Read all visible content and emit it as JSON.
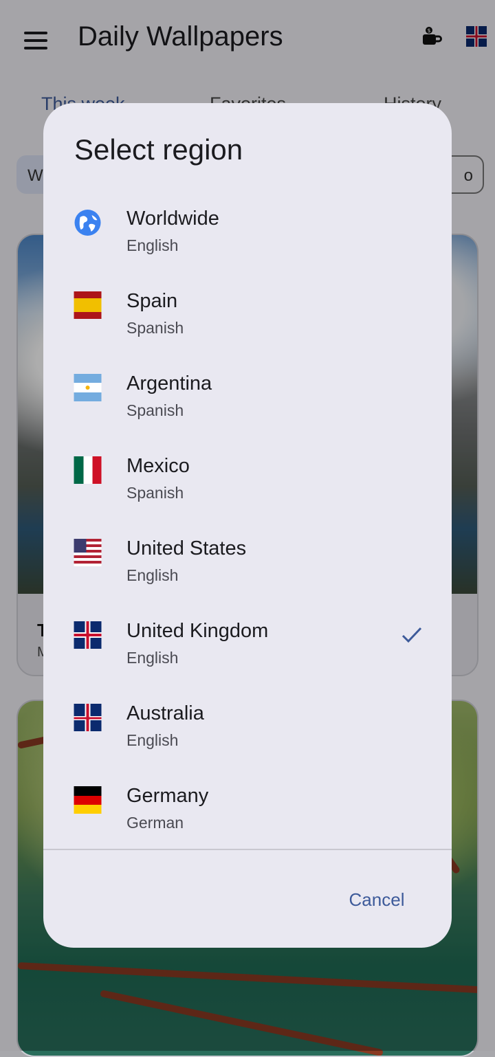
{
  "app": {
    "title": "Daily Wallpapers",
    "tabs": [
      "This week",
      "Favorites",
      "History"
    ],
    "chips": [
      "W",
      "o"
    ],
    "card1": {
      "caption_title": "T",
      "caption_sub": "M"
    }
  },
  "dialog": {
    "title": "Select region",
    "selected_region": "United Kingdom",
    "regions": [
      {
        "name": "Worldwide",
        "language": "English",
        "icon": "globe-icon"
      },
      {
        "name": "Spain",
        "language": "Spanish",
        "icon": "spain-flag-icon"
      },
      {
        "name": "Argentina",
        "language": "Spanish",
        "icon": "argentina-flag-icon"
      },
      {
        "name": "Mexico",
        "language": "Spanish",
        "icon": "mexico-flag-icon"
      },
      {
        "name": "United States",
        "language": "English",
        "icon": "usa-flag-icon"
      },
      {
        "name": "United Kingdom",
        "language": "English",
        "icon": "uk-flag-icon"
      },
      {
        "name": "Australia",
        "language": "English",
        "icon": "australia-flag-icon"
      },
      {
        "name": "Germany",
        "language": "German",
        "icon": "germany-flag-icon"
      }
    ],
    "cancel_label": "Cancel"
  },
  "colors": {
    "accent": "#3d5a9a",
    "dialog_bg": "#e9e8f1"
  }
}
